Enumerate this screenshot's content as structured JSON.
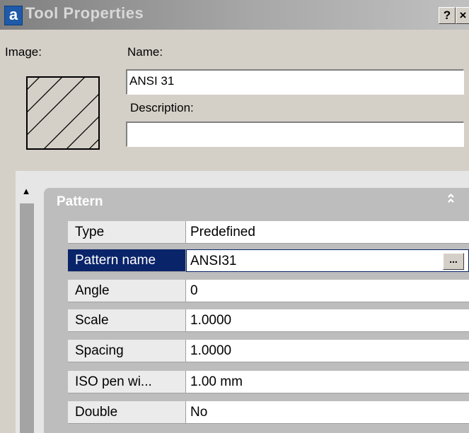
{
  "window": {
    "app_icon_letter": "a",
    "title": "Tool Properties",
    "help_label": "?",
    "close_label": "×"
  },
  "form": {
    "image_label": "Image:",
    "name_label": "Name:",
    "name_value": "ANSI 31",
    "description_label": "Description:",
    "description_value": ""
  },
  "palette": {
    "category": "Pattern",
    "collapse_glyph": "⌃",
    "ellipsis_label": "...",
    "rows": [
      {
        "name": "Type",
        "value": "Predefined"
      },
      {
        "name": "Pattern name",
        "value": "ANSI31"
      },
      {
        "name": "Angle",
        "value": "0"
      },
      {
        "name": "Scale",
        "value": "1.0000"
      },
      {
        "name": "Spacing",
        "value": "1.0000"
      },
      {
        "name": "ISO pen wi...",
        "value": "1.00 mm"
      },
      {
        "name": "Double",
        "value": "No"
      }
    ]
  },
  "colors": {
    "selection": "#0a246a",
    "dialog_bg": "#d4d0c8"
  }
}
